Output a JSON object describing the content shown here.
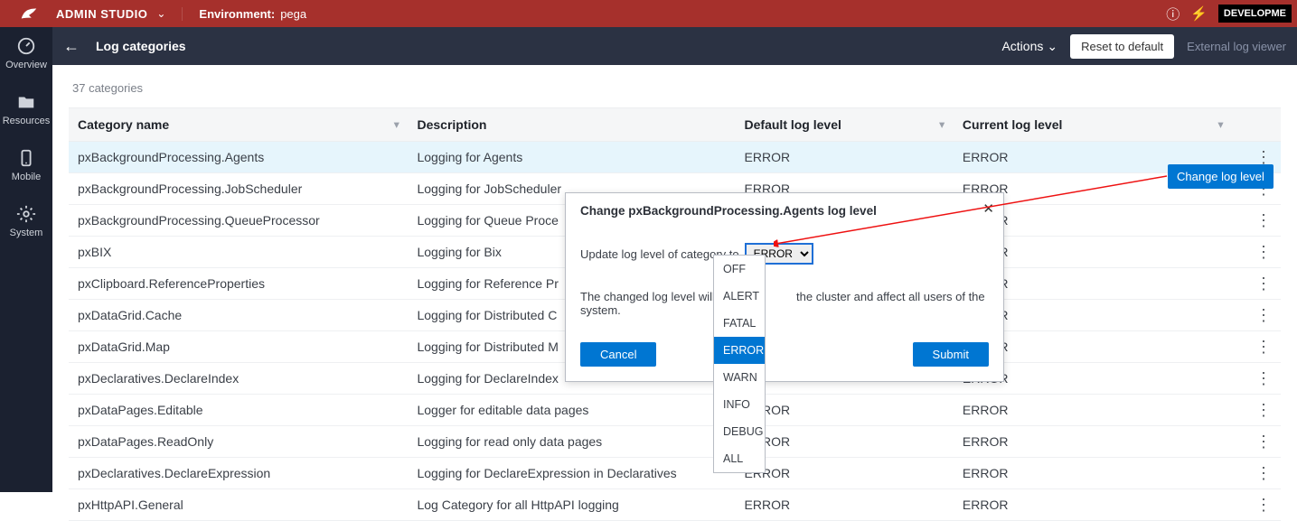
{
  "topbar": {
    "app_title": "ADMIN STUDIO",
    "env_label": "Environment:",
    "env_value": "pega",
    "dev_tag": "DEVELOPME"
  },
  "subbar": {
    "page_title": "Log categories",
    "actions_label": "Actions",
    "reset_label": "Reset to default",
    "external_label": "External log viewer"
  },
  "sidebar": {
    "items": [
      {
        "label": "Overview"
      },
      {
        "label": "Resources"
      },
      {
        "label": "Mobile"
      },
      {
        "label": "System"
      }
    ]
  },
  "content": {
    "count_text": "37 categories",
    "columns": {
      "name": "Category name",
      "desc": "Description",
      "def": "Default log level",
      "cur": "Current log level"
    },
    "rows": [
      {
        "name": "pxBackgroundProcessing.Agents",
        "desc": "Logging for Agents",
        "def": "ERROR",
        "cur": "ERROR",
        "sel": true
      },
      {
        "name": "pxBackgroundProcessing.JobScheduler",
        "desc": "Logging for JobScheduler",
        "def": "ERROR",
        "cur": "ERROR"
      },
      {
        "name": "pxBackgroundProcessing.QueueProcessor",
        "desc": "Logging for Queue Proce",
        "def": "",
        "cur": "ERROR"
      },
      {
        "name": "pxBIX",
        "desc": "Logging for Bix",
        "def": "",
        "cur": "ERROR"
      },
      {
        "name": "pxClipboard.ReferenceProperties",
        "desc": "Logging for Reference Pr",
        "def": "",
        "cur": "ERROR"
      },
      {
        "name": "pxDataGrid.Cache",
        "desc": "Logging for Distributed C",
        "def": "",
        "cur": "ERROR"
      },
      {
        "name": "pxDataGrid.Map",
        "desc": "Logging for Distributed M",
        "def": "",
        "cur": "ERROR"
      },
      {
        "name": "pxDeclaratives.DeclareIndex",
        "desc": "Logging for DeclareIndex",
        "def": "",
        "cur": "ERROR"
      },
      {
        "name": "pxDataPages.Editable",
        "desc": "Logger for editable data pages",
        "def": "ERROR",
        "cur": "ERROR"
      },
      {
        "name": "pxDataPages.ReadOnly",
        "desc": "Logging for read only data pages",
        "def": "ERROR",
        "cur": "ERROR"
      },
      {
        "name": "pxDeclaratives.DeclareExpression",
        "desc": "Logging for DeclareExpression in Declaratives",
        "def": "ERROR",
        "cur": "ERROR"
      },
      {
        "name": "pxHttpAPI.General",
        "desc": "Log Category for all HttpAPI logging",
        "def": "ERROR",
        "cur": "ERROR"
      }
    ]
  },
  "context_menu": {
    "change_label": "Change log level"
  },
  "dialog": {
    "title": "Change pxBackgroundProcessing.Agents log level",
    "row1_pre": "Update log level of category to",
    "select_value": "ERROR",
    "row2_pre": "The changed log level will be a",
    "row2_post": " the cluster and affect all users of the system.",
    "cancel": "Cancel",
    "submit": "Submit"
  },
  "dropdown": {
    "options": [
      "OFF",
      "ALERT",
      "FATAL",
      "ERROR",
      "WARN",
      "INFO",
      "DEBUG",
      "ALL"
    ],
    "selected": "ERROR"
  }
}
